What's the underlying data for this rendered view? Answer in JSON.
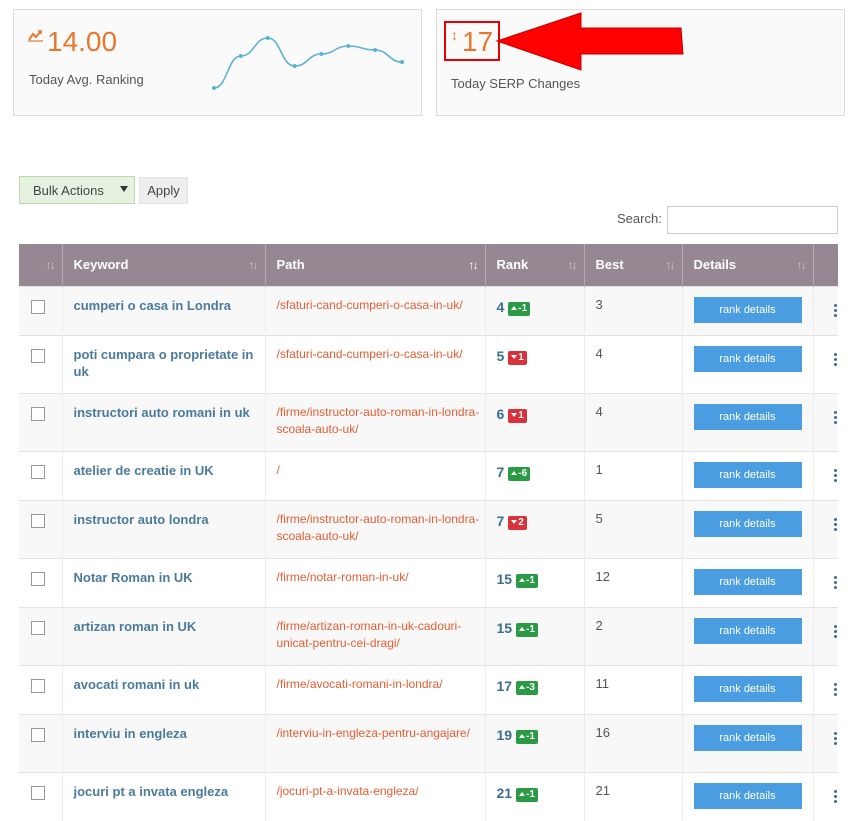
{
  "stats": {
    "avg_ranking": {
      "value": "14.00",
      "label": "Today Avg. Ranking",
      "icon": "trend-icon",
      "sparkline": [
        6,
        22,
        31,
        17,
        23,
        27,
        25,
        19
      ]
    },
    "serp_changes": {
      "value": "17",
      "label": "Today SERP Changes",
      "icon": "updown-arrow-icon"
    }
  },
  "toolbar": {
    "bulk_actions": "Bulk Actions",
    "apply": "Apply",
    "search_label": "Search:",
    "search_value": ""
  },
  "table": {
    "headers": [
      "",
      "Keyword",
      "Path",
      "Rank",
      "Best",
      "Details",
      ""
    ],
    "rows": [
      {
        "keyword": "cumperi o casa in Londra",
        "path": "/sfaturi-cand-cumperi-o-casa-in-uk/",
        "rank": "4",
        "change": "-1",
        "dir": "up",
        "best": "3",
        "details": "rank details"
      },
      {
        "keyword": "poti cumpara o proprietate in uk",
        "path": "/sfaturi-cand-cumperi-o-casa-in-uk/",
        "rank": "5",
        "change": "1",
        "dir": "down",
        "best": "4",
        "details": "rank details"
      },
      {
        "keyword": "instructori auto romani in uk",
        "path": "/firme/instructor-auto-roman-in-londra-scoala-auto-uk/",
        "rank": "6",
        "change": "1",
        "dir": "down",
        "best": "4",
        "details": "rank details"
      },
      {
        "keyword": "atelier de creatie in UK",
        "path": "/",
        "rank": "7",
        "change": "-6",
        "dir": "up",
        "best": "1",
        "details": "rank details"
      },
      {
        "keyword": "instructor auto londra",
        "path": "/firme/instructor-auto-roman-in-londra-scoala-auto-uk/",
        "rank": "7",
        "change": "2",
        "dir": "down",
        "best": "5",
        "details": "rank details"
      },
      {
        "keyword": "Notar Roman in UK",
        "path": "/firme/notar-roman-in-uk/",
        "rank": "15",
        "change": "-1",
        "dir": "up",
        "best": "12",
        "details": "rank details"
      },
      {
        "keyword": "artizan roman in UK",
        "path": "/firme/artizan-roman-in-uk-cadouri-unicat-pentru-cei-dragi/",
        "rank": "15",
        "change": "-1",
        "dir": "up",
        "best": "2",
        "details": "rank details"
      },
      {
        "keyword": "avocati romani in uk",
        "path": "/firme/avocati-romani-in-londra/",
        "rank": "17",
        "change": "-3",
        "dir": "up",
        "best": "11",
        "details": "rank details"
      },
      {
        "keyword": "interviu in engleza",
        "path": "/interviu-in-engleza-pentru-angajare/",
        "rank": "19",
        "change": "-1",
        "dir": "up",
        "best": "16",
        "details": "rank details"
      },
      {
        "keyword": "jocuri pt a invata engleza",
        "path": "/jocuri-pt-a-invata-engleza/",
        "rank": "21",
        "change": "-1",
        "dir": "up",
        "best": "21",
        "details": "rank details"
      }
    ]
  },
  "colors": {
    "accent": "#e8772e",
    "header_bg": "#968892",
    "button": "#4a9de0",
    "up": "#2a9b44",
    "down": "#d9323a",
    "keyword": "#4a7a9c",
    "path": "#e45d33",
    "annotation": "#e60000"
  }
}
